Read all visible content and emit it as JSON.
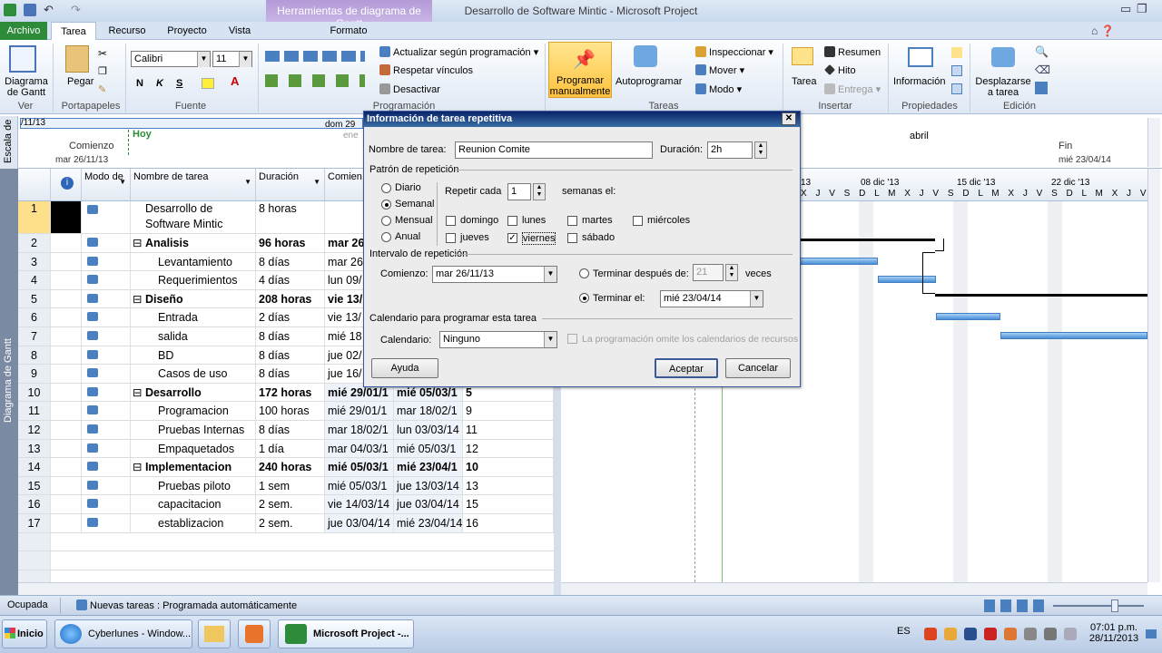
{
  "window": {
    "title": "Desarrollo de Software Mintic - Microsoft Project",
    "context_tab": "Herramientas de diagrama de Gantt"
  },
  "tabs": [
    "Archivo",
    "Tarea",
    "Recurso",
    "Proyecto",
    "Vista",
    "Formato"
  ],
  "ribbon": {
    "ver": {
      "label": "Ver",
      "gantt": "Diagrama de Gantt"
    },
    "portapapeles": {
      "label": "Portapapeles",
      "pegar": "Pegar"
    },
    "fuente": {
      "label": "Fuente",
      "font": "Calibri",
      "size": "11",
      "bold": "N",
      "italic": "K",
      "underline": "S"
    },
    "programacion": {
      "label": "Programación",
      "actualizar": "Actualizar según programación",
      "respetar": "Respetar vínculos",
      "desactivar": "Desactivar"
    },
    "tareas": {
      "label": "Tareas",
      "programar": "Programar manualmente",
      "auto": "Autoprogramar",
      "inspeccionar": "Inspeccionar",
      "mover": "Mover",
      "modo": "Modo"
    },
    "insertar": {
      "label": "Insertar",
      "tarea": "Tarea",
      "resumen": "Resumen",
      "hito": "Hito",
      "entrega": "Entrega"
    },
    "propiedades": {
      "label": "Propiedades",
      "informacion": "Información"
    },
    "edicion": {
      "label": "Edición",
      "desplazarse": "Desplazarse a tarea"
    }
  },
  "timeline": {
    "side": "Escala de",
    "start_tick": "/11/13",
    "hoy": "Hoy",
    "comienzo": "Comienzo",
    "comienzo_date": "mar 26/11/13",
    "mid_tick": "dom 29",
    "mid_sub": "ene",
    "abril": "abril",
    "fin": "Fin",
    "fin_date": "mié 23/04/14"
  },
  "sidebar": {
    "label": "Diagrama de Gantt"
  },
  "columns": {
    "modo": "Modo de",
    "nombre": "Nombre de tarea",
    "duracion": "Duración",
    "comienzo": "Comien"
  },
  "rows": [
    {
      "id": "1",
      "name": "Desarrollo de",
      "name2": "Software Mintic",
      "dur": "8 horas",
      "start": "",
      "end": "",
      "pred": "",
      "sum": false
    },
    {
      "id": "2",
      "name": "Analisis",
      "dur": "96 horas",
      "start": "mar 26",
      "end": "",
      "pred": "",
      "sum": true
    },
    {
      "id": "3",
      "name": "Levantamiento",
      "dur": "8 días",
      "start": "mar 26",
      "end": "",
      "pred": "",
      "sum": false
    },
    {
      "id": "4",
      "name": "Requerimientos",
      "dur": "4 días",
      "start": "lun 09/",
      "end": "",
      "pred": "",
      "sum": false
    },
    {
      "id": "5",
      "name": "Diseño",
      "dur": "208 horas",
      "start": "vie 13/",
      "end": "",
      "pred": "",
      "sum": true
    },
    {
      "id": "6",
      "name": "Entrada",
      "dur": "2 días",
      "start": "vie 13/",
      "end": "",
      "pred": "",
      "sum": false
    },
    {
      "id": "7",
      "name": "salida",
      "dur": "8 días",
      "start": "mié 18",
      "end": "",
      "pred": "",
      "sum": false
    },
    {
      "id": "8",
      "name": "BD",
      "dur": "8 días",
      "start": "jue 02/",
      "end": "",
      "pred": "",
      "sum": false
    },
    {
      "id": "9",
      "name": "Casos de uso",
      "dur": "8 días",
      "start": "jue 16/",
      "end": "",
      "pred": "",
      "sum": false
    },
    {
      "id": "10",
      "name": "Desarrollo",
      "dur": "172 horas",
      "start": "mié 29/01/1",
      "end": "mié 05/03/1",
      "pred": "5",
      "sum": true
    },
    {
      "id": "11",
      "name": "Programacion",
      "dur": "100 horas",
      "start": "mié 29/01/1",
      "end": "mar 18/02/1",
      "pred": "9",
      "sum": false
    },
    {
      "id": "12",
      "name": "Pruebas Internas",
      "dur": "8 días",
      "start": "mar 18/02/1",
      "end": "lun 03/03/14",
      "pred": "11",
      "sum": false
    },
    {
      "id": "13",
      "name": "Empaquetados",
      "dur": "1 día",
      "start": "mar 04/03/1",
      "end": "mié 05/03/1",
      "pred": "12",
      "sum": false
    },
    {
      "id": "14",
      "name": "Implementacion",
      "dur": "240 horas",
      "start": "mié 05/03/1",
      "end": "mié 23/04/1",
      "pred": "10",
      "sum": true
    },
    {
      "id": "15",
      "name": "Pruebas piloto",
      "dur": "1 sem",
      "start": "mié 05/03/1",
      "end": "jue 13/03/14",
      "pred": "13",
      "sum": false
    },
    {
      "id": "16",
      "name": "capacitacion",
      "dur": "2 sem.",
      "start": "vie 14/03/14",
      "end": "jue 03/04/14",
      "pred": "15",
      "sum": false
    },
    {
      "id": "17",
      "name": "establizacion",
      "dur": "2 sem.",
      "start": "jue 03/04/14",
      "end": "mié 23/04/14",
      "pred": "16",
      "sum": false
    }
  ],
  "chart": {
    "weeks": [
      "08 dic '13",
      "15 dic '13",
      "22 dic '13"
    ],
    "first_tick": "13",
    "days": "X J V S D L M X J V S D L M X J V S D L M X J V S D L M X J V S"
  },
  "dialog": {
    "title": "Información de tarea repetitiva",
    "nombre_label": "Nombre de tarea:",
    "nombre": "Reunion Comite",
    "duracion_label": "Duración:",
    "duracion": "2h",
    "patron": "Patrón de repetición",
    "diario": "Diario",
    "semanal": "Semanal",
    "mensual": "Mensual",
    "anual": "Anual",
    "repetir": "Repetir cada",
    "repetir_val": "1",
    "semanas": "semanas el:",
    "domingo": "domingo",
    "lunes": "lunes",
    "martes": "martes",
    "miercoles": "miércoles",
    "jueves": "jueves",
    "viernes": "viernes",
    "sabado": "sábado",
    "intervalo": "Intervalo de repetición",
    "comienzo_label": "Comienzo:",
    "comienzo": "mar 26/11/13",
    "despues": "Terminar después de:",
    "veces_val": "21",
    "veces": "veces",
    "terminar_el": "Terminar el:",
    "terminar_val": "mié 23/04/14",
    "calendario_hdr": "Calendario para programar esta tarea",
    "calendario_label": "Calendario:",
    "calendario": "Ninguno",
    "omite": "La programación omite los calendarios de recursos",
    "ayuda": "Ayuda",
    "aceptar": "Aceptar",
    "cancelar": "Cancelar"
  },
  "status": {
    "ocupada": "Ocupada",
    "nuevas": "Nuevas tareas : Programada automáticamente"
  },
  "taskbar": {
    "inicio": "Inicio",
    "browser": "Cyberlunes - Window...",
    "project": "Microsoft Project -...",
    "lang": "ES",
    "time": "07:01 p.m.",
    "date": "28/11/2013"
  }
}
